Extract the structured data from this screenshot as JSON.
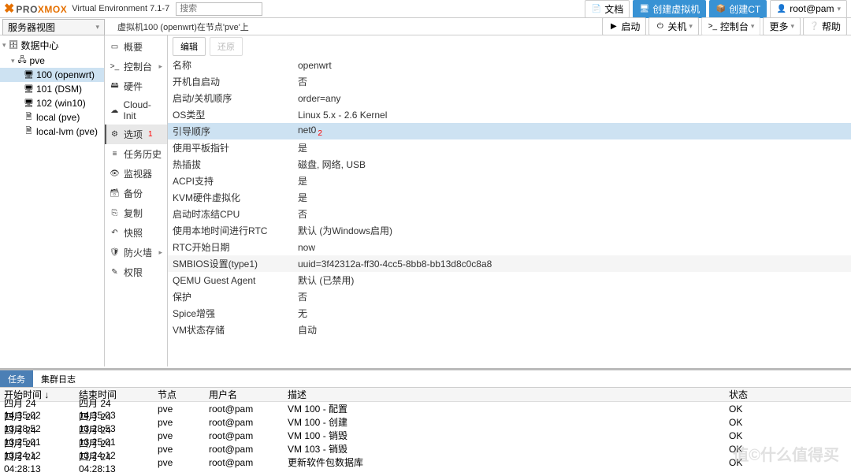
{
  "header": {
    "product": "PROXMOX",
    "version": "Virtual Environment 7.1-7",
    "search_placeholder": "搜索",
    "docs": "文档",
    "create_vm": "创建虚拟机",
    "create_ct": "创建CT",
    "user": "root@pam"
  },
  "viewselect": "服务器视图",
  "breadcrumb": "虚拟机100 (openwrt)在节点'pve'上",
  "actions": {
    "start": "启动",
    "shutdown": "关机",
    "console": "控制台",
    "more": "更多",
    "help": "帮助"
  },
  "tree": [
    {
      "lvl": 0,
      "icon": "server-icon",
      "label": "数据中心"
    },
    {
      "lvl": 1,
      "icon": "node-icon",
      "label": "pve"
    },
    {
      "lvl": 2,
      "icon": "vm-icon",
      "label": "100 (openwrt)",
      "sel": true
    },
    {
      "lvl": 2,
      "icon": "vm-run-icon",
      "label": "101 (DSM)"
    },
    {
      "lvl": 2,
      "icon": "vm-icon",
      "label": "102 (win10)"
    },
    {
      "lvl": 2,
      "icon": "storage-icon",
      "label": "local (pve)"
    },
    {
      "lvl": 2,
      "icon": "storage-icon",
      "label": "local-lvm (pve)"
    }
  ],
  "nav": [
    {
      "icon": "summary-icon",
      "label": "概要"
    },
    {
      "icon": "console-icon",
      "label": "控制台",
      "sub": true
    },
    {
      "icon": "hardware-icon",
      "label": "硬件"
    },
    {
      "icon": "cloud-icon",
      "label": "Cloud-Init"
    },
    {
      "icon": "options-icon",
      "label": "选项",
      "sel": true,
      "badge": "1"
    },
    {
      "icon": "history-icon",
      "label": "任务历史"
    },
    {
      "icon": "monitor-icon",
      "label": "监视器"
    },
    {
      "icon": "backup-icon",
      "label": "备份"
    },
    {
      "icon": "replication-icon",
      "label": "复制"
    },
    {
      "icon": "snapshot-icon",
      "label": "快照"
    },
    {
      "icon": "firewall-icon",
      "label": "防火墙",
      "sub": true
    },
    {
      "icon": "permission-icon",
      "label": "权限"
    }
  ],
  "toolbar": {
    "edit": "编辑",
    "revert": "还原"
  },
  "options": [
    {
      "k": "名称",
      "v": "openwrt"
    },
    {
      "k": "开机自启动",
      "v": "否"
    },
    {
      "k": "启动/关机顺序",
      "v": "order=any"
    },
    {
      "k": "OS类型",
      "v": "Linux 5.x - 2.6 Kernel"
    },
    {
      "k": "引导顺序",
      "v": "net0",
      "hl": true,
      "badge": "2"
    },
    {
      "k": "使用平板指针",
      "v": "是"
    },
    {
      "k": "热插拔",
      "v": "磁盘, 网络, USB"
    },
    {
      "k": "ACPI支持",
      "v": "是"
    },
    {
      "k": "KVM硬件虚拟化",
      "v": "是"
    },
    {
      "k": "启动时冻结CPU",
      "v": "否"
    },
    {
      "k": "使用本地时间进行RTC",
      "v": "默认 (为Windows启用)"
    },
    {
      "k": "RTC开始日期",
      "v": "now"
    },
    {
      "k": "SMBIOS设置(type1)",
      "v": "uuid=3f42312a-ff30-4cc5-8bb8-bb13d8c0c8a8",
      "alt": true
    },
    {
      "k": "QEMU Guest Agent",
      "v": "默认 (已禁用)"
    },
    {
      "k": "保护",
      "v": "否"
    },
    {
      "k": "Spice增强",
      "v": "无"
    },
    {
      "k": "VM状态存储",
      "v": "自动"
    }
  ],
  "tabs": {
    "tasks": "任务",
    "cluster": "集群日志"
  },
  "log_headers": {
    "start": "开始时间 ↓",
    "end": "结束时间",
    "node": "节点",
    "user": "用户名",
    "desc": "描述",
    "status": "状态"
  },
  "logs": [
    {
      "s": "四月 24 14:35:02",
      "e": "四月 24 14:35:03",
      "n": "pve",
      "u": "root@pam",
      "d": "VM 100 - 配置",
      "st": "OK"
    },
    {
      "s": "四月 24 13:28:52",
      "e": "四月 24 13:28:53",
      "n": "pve",
      "u": "root@pam",
      "d": "VM 100 - 创建",
      "st": "OK"
    },
    {
      "s": "四月 24 13:25:01",
      "e": "四月 24 13:25:01",
      "n": "pve",
      "u": "root@pam",
      "d": "VM 100 - 销毁",
      "st": "OK"
    },
    {
      "s": "四月 24 13:24:12",
      "e": "四月 24 13:24:12",
      "n": "pve",
      "u": "root@pam",
      "d": "VM 103 - 销毁",
      "st": "OK"
    },
    {
      "s": "四月 24 04:28:13",
      "e": "四月 24 04:28:13",
      "n": "pve",
      "u": "root@pam",
      "d": "更新软件包数据库",
      "st": "OK"
    }
  ],
  "watermark": "值©什么值得买"
}
